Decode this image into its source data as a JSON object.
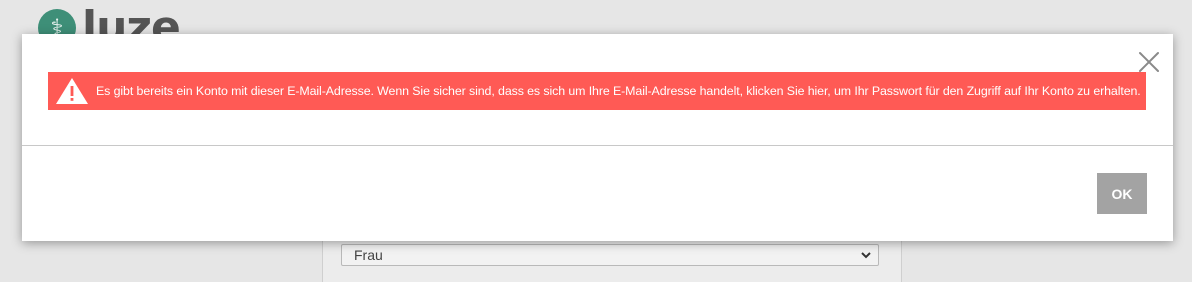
{
  "background": {
    "logo": {
      "text": "luze",
      "icon": "pharmacy-logo-icon"
    },
    "select": {
      "value": "Frau",
      "icon": "chevron-down-icon"
    }
  },
  "modal": {
    "close_icon": "close-icon",
    "alert": {
      "icon": "warning-icon",
      "color": "#ff5a55",
      "message": "Es gibt bereits ein Konto mit dieser E-Mail-Adresse. Wenn Sie sicher sind, dass es sich um Ihre E-Mail-Adresse handelt, klicken Sie hier, um Ihr Passwort für den Zugriff auf Ihr Konto zu erhalten."
    },
    "ok_label": "OK"
  }
}
